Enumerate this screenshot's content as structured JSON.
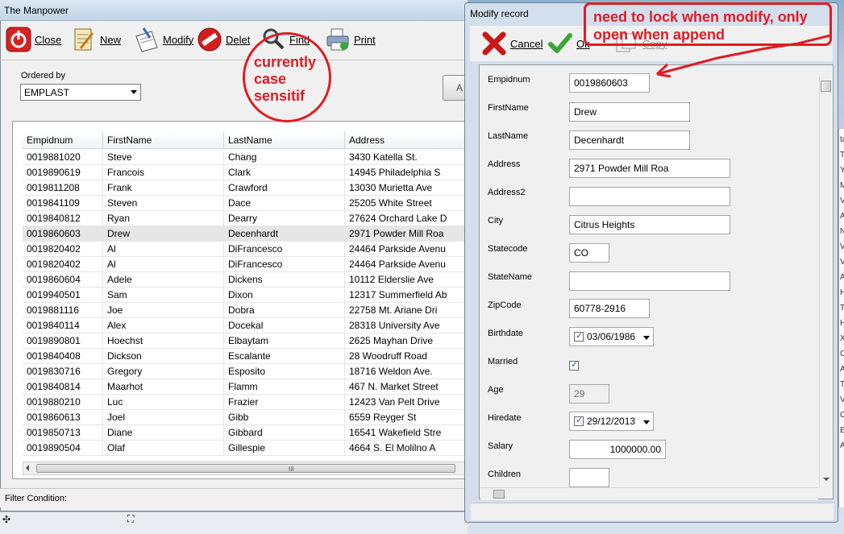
{
  "main_window": {
    "title": "The Manpower",
    "toolbar": {
      "close": "Close",
      "new": "New",
      "modify": "Modify",
      "delete": "Delet",
      "find": "Find",
      "print": "Print"
    },
    "ordered_by_label": "Ordered by",
    "ordered_by_value": "EMPLAST",
    "side_button": "A",
    "grid": {
      "columns": [
        "Empidnum",
        "FirstName",
        "LastName",
        "Address"
      ],
      "rows": [
        [
          "0019881020",
          "Steve",
          "Chang",
          "3430 Katella St."
        ],
        [
          "0019890619",
          "Francois",
          "Clark",
          "14945 Philadelphia S"
        ],
        [
          "0019811208",
          "Frank",
          "Crawford",
          "13030 Murietta Ave"
        ],
        [
          "0019841109",
          "Steven",
          "Dace",
          "25205 White Street"
        ],
        [
          "0019840812",
          "Ryan",
          "Dearry",
          "27624 Orchard Lake D"
        ],
        [
          "0019860603",
          "Drew",
          "Decenhardt",
          "2971 Powder Mill Roa"
        ],
        [
          "0019820402",
          "Al",
          "DiFrancesco",
          "24464 Parkside Avenu"
        ],
        [
          "0019820402",
          "Al",
          "DiFrancesco",
          "24464 Parkside Avenu"
        ],
        [
          "0019860604",
          "Adele",
          "Dickens",
          "10112 Elderslie Ave"
        ],
        [
          "0019940501",
          "Sam",
          "Dixon",
          "12317 Summerfield Ab"
        ],
        [
          "0019881116",
          "Joe",
          "Dobra",
          "22758 Mt. Ariane Dri"
        ],
        [
          "0019840114",
          "Alex",
          "Docekal",
          "28318 University Ave"
        ],
        [
          "0019890801",
          "Hoechst",
          "Elbaytam",
          "2625 Mayhan Drive"
        ],
        [
          "0019840408",
          "Dickson",
          "Escalante",
          "28 Woodruff Road"
        ],
        [
          "0019830716",
          "Gregory",
          "Esposito",
          "18716 Weldon Ave."
        ],
        [
          "0019840814",
          "Maarhot",
          "Flamm",
          "467 N. Market Street"
        ],
        [
          "0019880210",
          "Luc",
          "Frazier",
          "12423 Van Pelt Drive"
        ],
        [
          "0019860613",
          "Joel",
          "Gibb",
          "6559 Reyger St"
        ],
        [
          "0019850713",
          "Diane",
          "Gibbard",
          "16541 Wakefield Stre"
        ],
        [
          "0019890504",
          "Olaf",
          "Gillespie",
          "4664 S. El Molilno A"
        ]
      ],
      "selected_row": 5
    },
    "scroll_grip": "III",
    "status": "Filter Condition:"
  },
  "modify_window": {
    "title": "Modify record",
    "toolbar": {
      "cancel": "Cancel",
      "ok": "Ok",
      "copy": "Copy"
    },
    "fields": {
      "empidnum": {
        "label": "Empidnum",
        "value": "0019860603"
      },
      "firstname": {
        "label": "FirstName",
        "value": "Drew"
      },
      "lastname": {
        "label": "LastName",
        "value": "Decenhardt"
      },
      "address": {
        "label": "Address",
        "value": "2971 Powder Mill Roa"
      },
      "address2": {
        "label": "Address2",
        "value": ""
      },
      "city": {
        "label": "City",
        "value": "Citrus Heights"
      },
      "statecode": {
        "label": "Statecode",
        "value": "CO"
      },
      "statename": {
        "label": "StateName",
        "value": ""
      },
      "zipcode": {
        "label": "ZipCode",
        "value": "60778-2916"
      },
      "birthdate": {
        "label": "Birthdate",
        "value": "03/06/1986"
      },
      "married": {
        "label": "Married",
        "value": true
      },
      "age": {
        "label": "Age",
        "value": "29"
      },
      "hiredate": {
        "label": "Hiredate",
        "value": "29/12/2013"
      },
      "salary": {
        "label": "Salary",
        "value": "1000000.00"
      },
      "children": {
        "label": "Children",
        "value": ""
      }
    }
  },
  "annotations": {
    "find_note": "currently case sensitif",
    "lock_note": "need to lock when modify, only open when append",
    "color": "#e01b24"
  },
  "taskbar": {
    "left_glyph": "✣",
    "mid_glyph": "⛶"
  },
  "right_edge_letters": [
    "ta",
    "T",
    "Y",
    "M",
    "V",
    "A",
    "N",
    "V",
    "V",
    "A",
    "H",
    "T",
    "H",
    "X",
    "C",
    "A",
    "T",
    "V",
    "C",
    "E",
    "A"
  ]
}
